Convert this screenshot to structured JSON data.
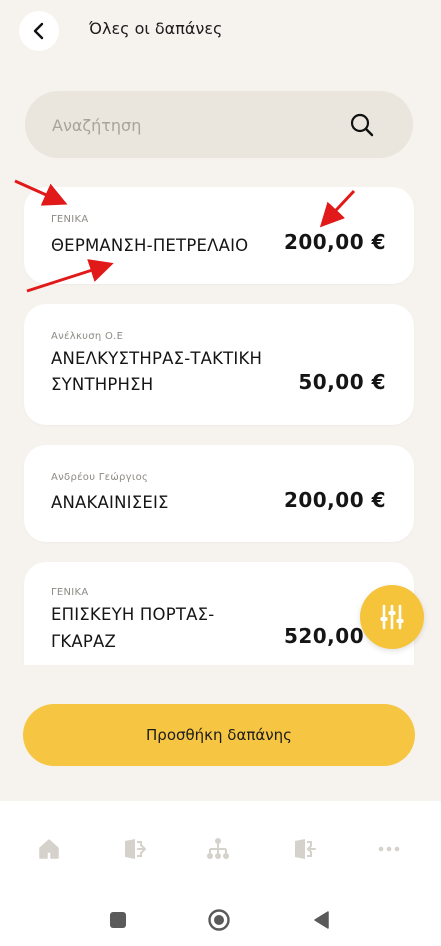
{
  "header": {
    "title": "Όλες οι δαπάνες"
  },
  "search": {
    "placeholder": "Αναζήτηση"
  },
  "expenses": [
    {
      "category": "ΓΕΝΙΚΑ",
      "lines": [
        "ΘΕΡΜΑΝΣΗ-ΠΕΤΡΕΛΑΙΟ"
      ],
      "amount": "200,00 €"
    },
    {
      "category": "Ανέλκυση Ο.Ε",
      "lines": [
        "ΑΝΕΛΚΥΣΤΗΡΑΣ-ΤΑΚΤΙΚΗ",
        "ΣΥΝΤΗΡΗΣΗ"
      ],
      "amount": "50,00 €"
    },
    {
      "category": "Ανδρέου Γεώργιος",
      "lines": [
        "ΑΝΑΚΑΙΝΙΣΕΙΣ"
      ],
      "amount": "200,00 €"
    },
    {
      "category": "ΓΕΝΙΚΑ",
      "lines": [
        "ΕΠΙΣΚΕΥΗ ΠΟΡΤΑΣ-",
        "ΓΚΑΡΑΖ"
      ],
      "amount": "520,00 €"
    }
  ],
  "actions": {
    "add_expense_label": "Προσθήκη δαπάνης"
  },
  "bottom_nav": [
    {
      "icon": "home-icon"
    },
    {
      "icon": "door-exit-icon"
    },
    {
      "icon": "hierarchy-icon"
    },
    {
      "icon": "door-exit-icon"
    },
    {
      "icon": "more-icon"
    }
  ],
  "colors": {
    "accent": "#f6c643",
    "background": "#f6f3ee",
    "card": "#ffffff",
    "annotation": "#e11919"
  }
}
